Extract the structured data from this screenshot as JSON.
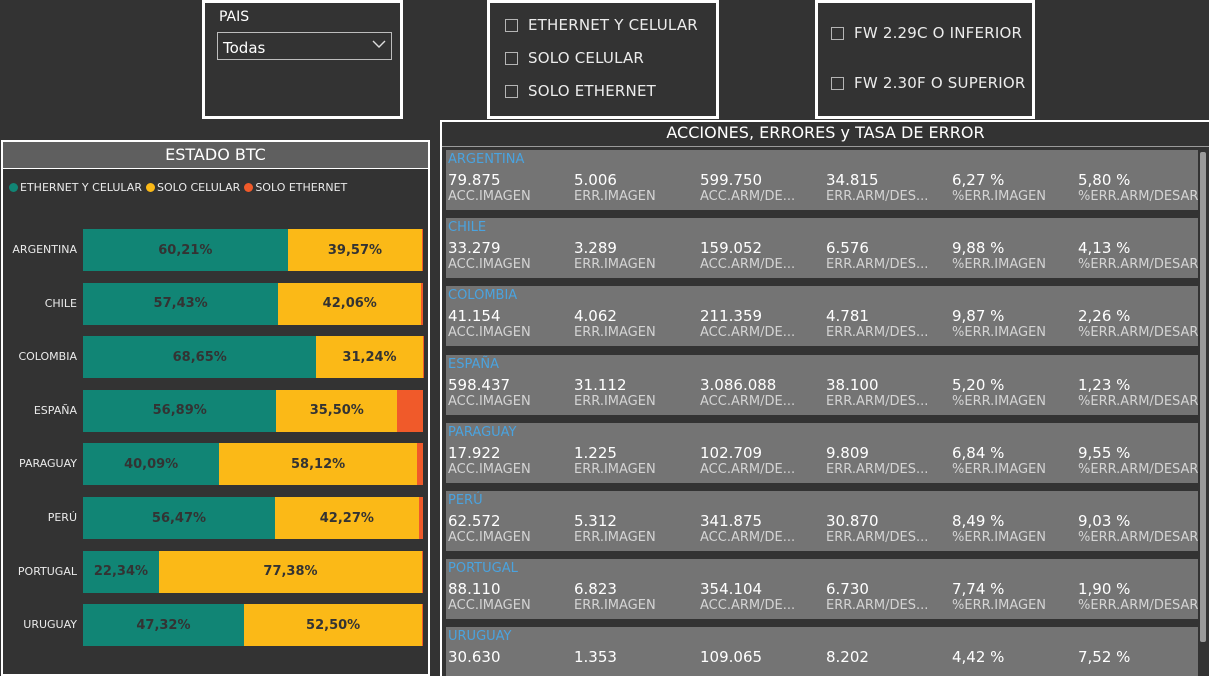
{
  "filters": {
    "pais": {
      "title": "PAIS",
      "selected": "Todas"
    },
    "connection_options": [
      "ETHERNET Y CELULAR",
      "SOLO CELULAR",
      "SOLO ETHERNET"
    ],
    "firmware_options": [
      "FW 2.29C O INFERIOR",
      "FW 2.30F O SUPERIOR"
    ]
  },
  "btc": {
    "title": "ESTADO BTC",
    "legend": [
      "ETHERNET Y CELULAR",
      "SOLO CELULAR",
      "SOLO ETHERNET"
    ],
    "colors": {
      "ethernet_celular": "#118575",
      "solo_celular": "#FBB917",
      "solo_ethernet": "#F05A2A"
    }
  },
  "chart_data": {
    "type": "bar",
    "stacked": true,
    "orientation": "horizontal",
    "title": "ESTADO BTC",
    "categories": [
      "ARGENTINA",
      "CHILE",
      "COLOMBIA",
      "ESPAÑA",
      "PARAGUAY",
      "PERÚ",
      "PORTUGAL",
      "URUGUAY"
    ],
    "series": [
      {
        "name": "ETHERNET Y CELULAR",
        "values": [
          60.21,
          57.43,
          68.65,
          56.89,
          40.09,
          56.47,
          22.34,
          47.32
        ],
        "labels": [
          "60,21%",
          "57,43%",
          "68,65%",
          "56,89%",
          "40,09%",
          "56,47%",
          "22,34%",
          "47,32%"
        ]
      },
      {
        "name": "SOLO CELULAR",
        "values": [
          39.57,
          42.06,
          31.24,
          35.5,
          58.12,
          42.27,
          77.38,
          52.5
        ],
        "labels": [
          "39,57%",
          "42,06%",
          "31,24%",
          "35,50%",
          "58,12%",
          "42,27%",
          "77,38%",
          "52,50%"
        ]
      },
      {
        "name": "SOLO ETHERNET",
        "values": [
          0.22,
          0.51,
          0.11,
          7.61,
          1.79,
          1.26,
          0.28,
          0.18
        ],
        "labels": [
          "",
          "",
          "",
          "",
          "",
          "",
          "",
          ""
        ]
      }
    ],
    "xlim": [
      0,
      100
    ],
    "grid": false,
    "legend_position": "top-left"
  },
  "acciones": {
    "title": "ACCIONES, ERRORES y TASA DE ERROR",
    "countries": [
      {
        "name": "ARGENTINA",
        "metrics": [
          {
            "value": "79.875",
            "label": "ACC.IMAGEN"
          },
          {
            "value": "5.006",
            "label": "ERR.IMAGEN"
          },
          {
            "value": "599.750",
            "label": "ACC.ARM/DE..."
          },
          {
            "value": "34.815",
            "label": "ERR.ARM/DES..."
          },
          {
            "value": "6,27 %",
            "label": "%ERR.IMAGEN"
          },
          {
            "value": "5,80 %",
            "label": "%ERR.ARM/DESAR"
          }
        ]
      },
      {
        "name": "CHILE",
        "metrics": [
          {
            "value": "33.279",
            "label": "ACC.IMAGEN"
          },
          {
            "value": "3.289",
            "label": "ERR.IMAGEN"
          },
          {
            "value": "159.052",
            "label": "ACC.ARM/DE..."
          },
          {
            "value": "6.576",
            "label": "ERR.ARM/DES..."
          },
          {
            "value": "9,88 %",
            "label": "%ERR.IMAGEN"
          },
          {
            "value": "4,13 %",
            "label": "%ERR.ARM/DESAR"
          }
        ]
      },
      {
        "name": "COLOMBIA",
        "metrics": [
          {
            "value": "41.154",
            "label": "ACC.IMAGEN"
          },
          {
            "value": "4.062",
            "label": "ERR.IMAGEN"
          },
          {
            "value": "211.359",
            "label": "ACC.ARM/DE..."
          },
          {
            "value": "4.781",
            "label": "ERR.ARM/DES..."
          },
          {
            "value": "9,87 %",
            "label": "%ERR.IMAGEN"
          },
          {
            "value": "2,26 %",
            "label": "%ERR.ARM/DESAR"
          }
        ]
      },
      {
        "name": "ESPAÑA",
        "metrics": [
          {
            "value": "598.437",
            "label": "ACC.IMAGEN"
          },
          {
            "value": "31.112",
            "label": "ERR.IMAGEN"
          },
          {
            "value": "3.086.088",
            "label": "ACC.ARM/DE..."
          },
          {
            "value": "38.100",
            "label": "ERR.ARM/DES..."
          },
          {
            "value": "5,20 %",
            "label": "%ERR.IMAGEN"
          },
          {
            "value": "1,23 %",
            "label": "%ERR.ARM/DESAR"
          }
        ]
      },
      {
        "name": "PARAGUAY",
        "metrics": [
          {
            "value": "17.922",
            "label": "ACC.IMAGEN"
          },
          {
            "value": "1.225",
            "label": "ERR.IMAGEN"
          },
          {
            "value": "102.709",
            "label": "ACC.ARM/DE..."
          },
          {
            "value": "9.809",
            "label": "ERR.ARM/DES..."
          },
          {
            "value": "6,84 %",
            "label": "%ERR.IMAGEN"
          },
          {
            "value": "9,55 %",
            "label": "%ERR.ARM/DESAR"
          }
        ]
      },
      {
        "name": "PERÚ",
        "metrics": [
          {
            "value": "62.572",
            "label": "ACC.IMAGEN"
          },
          {
            "value": "5.312",
            "label": "ERR.IMAGEN"
          },
          {
            "value": "341.875",
            "label": "ACC.ARM/DE..."
          },
          {
            "value": "30.870",
            "label": "ERR.ARM/DES..."
          },
          {
            "value": "8,49 %",
            "label": "%ERR.IMAGEN"
          },
          {
            "value": "9,03 %",
            "label": "%ERR.ARM/DESAR"
          }
        ]
      },
      {
        "name": "PORTUGAL",
        "metrics": [
          {
            "value": "88.110",
            "label": "ACC.IMAGEN"
          },
          {
            "value": "6.823",
            "label": "ERR.IMAGEN"
          },
          {
            "value": "354.104",
            "label": "ACC.ARM/DE..."
          },
          {
            "value": "6.730",
            "label": "ERR.ARM/DES..."
          },
          {
            "value": "7,74 %",
            "label": "%ERR.IMAGEN"
          },
          {
            "value": "1,90 %",
            "label": "%ERR.ARM/DESAR"
          }
        ]
      },
      {
        "name": "URUGUAY",
        "metrics": [
          {
            "value": "30.630",
            "label": ""
          },
          {
            "value": "1.353",
            "label": ""
          },
          {
            "value": "109.065",
            "label": ""
          },
          {
            "value": "8.202",
            "label": ""
          },
          {
            "value": "4,42 %",
            "label": ""
          },
          {
            "value": "7,52 %",
            "label": ""
          }
        ]
      }
    ]
  }
}
